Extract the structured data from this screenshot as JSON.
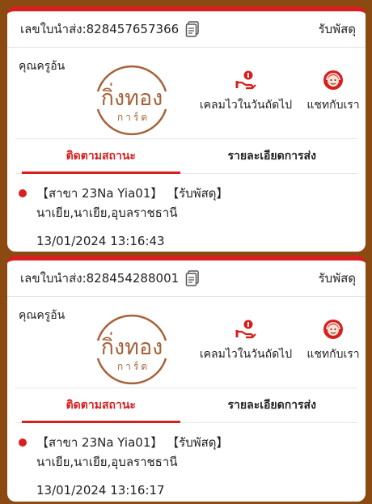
{
  "colors": {
    "accent": "#d81e1e",
    "logo": "#a6623a",
    "background": "#8a4a12"
  },
  "cards": [
    {
      "tracking_label": "เลขใบนำส่ง:828457657366",
      "receive_label": "รับพัสดุ",
      "recipient": "คุณครูอ้น",
      "logo_main": "กิ่งทอง",
      "logo_sub": "การ์ด",
      "claim_label": "เคลมไวในวันถัดไป",
      "chat_label": "แชทกับเรา",
      "tab_status": "ติดตามสถานะ",
      "tab_details": "รายละเอียดการส่ง",
      "event_line1": "【สาขา 23Na Yia01】 【รับพัสดุ】",
      "event_line2": "นาเยีย,นาเยีย,อุบลราชธานี",
      "event_time": "13/01/2024 13:16:43"
    },
    {
      "tracking_label": "เลขใบนำส่ง:828454288001",
      "receive_label": "รับพัสดุ",
      "recipient": "คุณครูอ้น",
      "logo_main": "กิ่งทอง",
      "logo_sub": "การ์ด",
      "claim_label": "เคลมไวในวันถัดไป",
      "chat_label": "แชทกับเรา",
      "tab_status": "ติดตามสถานะ",
      "tab_details": "รายละเอียดการส่ง",
      "event_line1": "【สาขา 23Na Yia01】 【รับพัสดุ】",
      "event_line2": "นาเยีย,นาเยีย,อุบลราชธานี",
      "event_time": "13/01/2024 13:16:17"
    }
  ],
  "icons": {
    "copy": "copy-icon",
    "claim": "hand-coin-icon",
    "chat": "support-agent-icon"
  }
}
